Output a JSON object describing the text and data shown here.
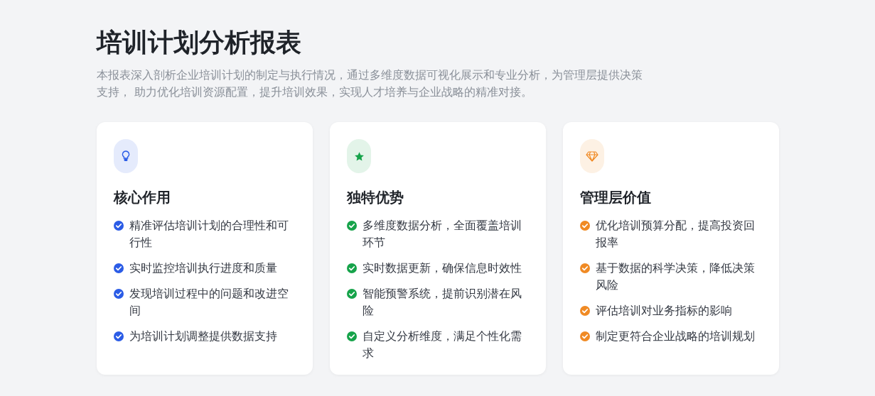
{
  "title": "培训计划分析报表",
  "description": "本报表深入剖析企业培训计划的制定与执行情况，通过多维度数据可视化展示和专业分析，为管理层提供决策支持， 助力优化培训资源配置，提升培训效果，实现人才培养与企业战略的精准对接。",
  "cards": [
    {
      "kind": "bulb",
      "color": "#2b5ce6",
      "heading": "核心作用",
      "items": [
        "精准评估培训计划的合理性和可行性",
        "实时监控培训执行进度和质量",
        "发现培训过程中的问题和改进空间",
        "为培训计划调整提供数据支持"
      ]
    },
    {
      "kind": "star",
      "color": "#16a34a",
      "heading": "独特优势",
      "items": [
        "多维度数据分析，全面覆盖培训环节",
        "实时数据更新，确保信息时效性",
        "智能预警系统，提前识别潜在风险",
        "自定义分析维度，满足个性化需求"
      ]
    },
    {
      "kind": "gem",
      "color": "#f08a24",
      "heading": "管理层价值",
      "items": [
        "优化培训预算分配，提高投资回报率",
        "基于数据的科学决策，降低决策风险",
        "评估培训对业务指标的影响",
        "制定更符合企业战略的培训规划"
      ]
    }
  ]
}
